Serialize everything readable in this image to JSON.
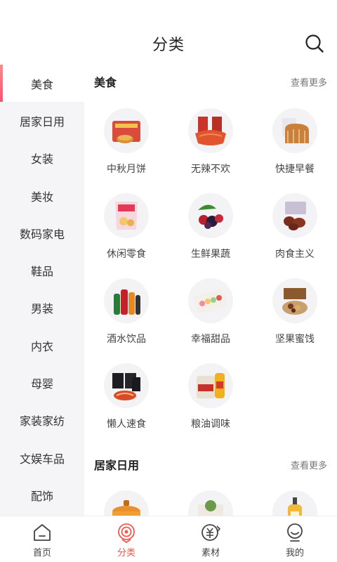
{
  "header": {
    "title": "分类"
  },
  "sidebar": {
    "items": [
      {
        "label": "美食"
      },
      {
        "label": "居家日用"
      },
      {
        "label": "女装"
      },
      {
        "label": "美妆"
      },
      {
        "label": "数码家电"
      },
      {
        "label": "鞋品"
      },
      {
        "label": "男装"
      },
      {
        "label": "内衣"
      },
      {
        "label": "母婴"
      },
      {
        "label": "家装家纺"
      },
      {
        "label": "文娱车品"
      },
      {
        "label": "配饰"
      }
    ],
    "active_index": 0
  },
  "sections": [
    {
      "title": "美食",
      "more": "查看更多",
      "items": [
        {
          "label": "中秋月饼",
          "icon": "mooncake-box-icon"
        },
        {
          "label": "无辣不欢",
          "icon": "spicy-snack-icon"
        },
        {
          "label": "快捷早餐",
          "icon": "bread-loaf-icon"
        },
        {
          "label": "休闲零食",
          "icon": "chips-bag-icon"
        },
        {
          "label": "生鲜果蔬",
          "icon": "berries-icon"
        },
        {
          "label": "肉食主义",
          "icon": "meat-jerky-icon"
        },
        {
          "label": "酒水饮品",
          "icon": "drink-bottles-icon"
        },
        {
          "label": "幸福甜品",
          "icon": "macaron-box-icon"
        },
        {
          "label": "坚果蜜饯",
          "icon": "nuts-gift-box-icon"
        },
        {
          "label": "懒人速食",
          "icon": "instant-noodles-icon"
        },
        {
          "label": "粮油调味",
          "icon": "rice-oil-icon"
        }
      ]
    },
    {
      "title": "居家日用",
      "more": "查看更多",
      "items": [
        {
          "label": "",
          "icon": "cooking-pot-icon"
        },
        {
          "label": "",
          "icon": "storage-box-icon"
        },
        {
          "label": "",
          "icon": "shampoo-bottle-icon"
        }
      ]
    }
  ],
  "tabbar": {
    "items": [
      {
        "label": "首页",
        "icon": "home-icon"
      },
      {
        "label": "分类",
        "icon": "category-icon"
      },
      {
        "label": "素材",
        "icon": "material-icon"
      },
      {
        "label": "我的",
        "icon": "profile-icon"
      }
    ],
    "active_index": 1
  },
  "colors": {
    "accent": "#f05a4a",
    "sidebar_bg": "#f5f5f7",
    "indicator": "#ff5a78"
  }
}
